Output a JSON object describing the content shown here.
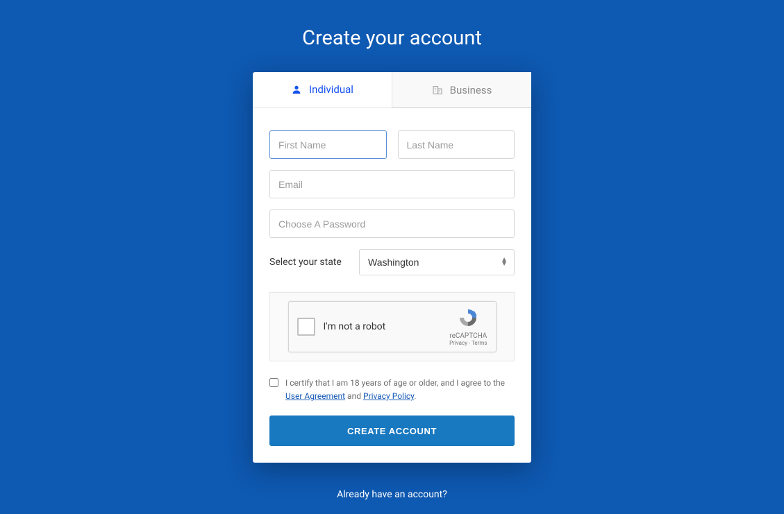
{
  "page": {
    "title": "Create your account"
  },
  "tabs": {
    "individual": {
      "label": "Individual"
    },
    "business": {
      "label": "Business"
    }
  },
  "form": {
    "first_name": {
      "value": "",
      "placeholder": "First Name"
    },
    "last_name": {
      "value": "",
      "placeholder": "Last Name"
    },
    "email": {
      "value": "",
      "placeholder": "Email"
    },
    "password": {
      "value": "",
      "placeholder": "Choose A Password"
    },
    "state": {
      "label": "Select your state",
      "selected": "Washington"
    }
  },
  "captcha": {
    "label": "I'm not a robot",
    "brand": "reCAPTCHA",
    "links": "Privacy - Terms"
  },
  "terms": {
    "prefix": "I certify that I am 18 years of age or older, and I agree to the ",
    "user_agreement": "User Agreement",
    "joiner": " and ",
    "privacy_policy": "Privacy Policy",
    "suffix": "."
  },
  "submit": {
    "label": "Create Account"
  },
  "footer": {
    "already": "Already have an account?"
  },
  "colors": {
    "background": "#0e59b2",
    "primary_link": "#1652f0",
    "button": "#1878c0"
  }
}
